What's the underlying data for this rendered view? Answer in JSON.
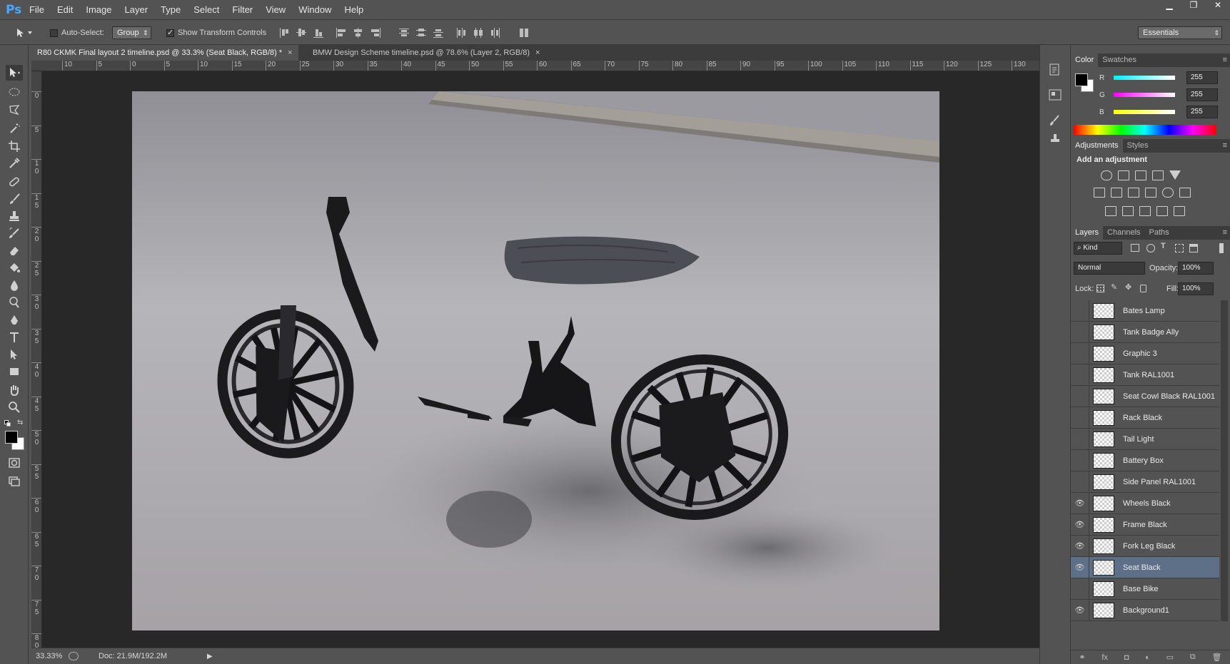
{
  "app": {
    "logo": "Ps"
  },
  "menu": [
    "File",
    "Edit",
    "Image",
    "Layer",
    "Type",
    "Select",
    "Filter",
    "View",
    "Window",
    "Help"
  ],
  "window_controls": {
    "minimize": "▁",
    "maximize": "❐",
    "close": "✕"
  },
  "options_bar": {
    "auto_select_label": "Auto-Select:",
    "auto_select_checked": false,
    "auto_select_target": "Group",
    "show_transform_label": "Show Transform Controls",
    "show_transform_checked": true,
    "workspace": "Essentials"
  },
  "tabs": [
    {
      "label": "R80 CKMK Final layout 2 timeline.psd @ 33.3% (Seat Black, RGB/8) *",
      "active": true,
      "close": "×"
    },
    {
      "label": "BMW Design Scheme timeline.psd @ 78.6% (Layer 2, RGB/8)",
      "active": false,
      "close": "×"
    }
  ],
  "ruler_h": [
    "10",
    "5",
    "0",
    "5",
    "10",
    "15",
    "20",
    "25",
    "30",
    "35",
    "40",
    "45",
    "50",
    "55",
    "60",
    "65",
    "70",
    "75",
    "80",
    "85",
    "90",
    "95",
    "100",
    "105",
    "110",
    "115",
    "120",
    "125",
    "130"
  ],
  "ruler_v": [
    "0",
    "5",
    "1 0",
    "1 5",
    "2 0",
    "2 5",
    "3 0",
    "3 5",
    "4 0",
    "4 5",
    "5 0",
    "5 5",
    "6 0",
    "6 5",
    "7 0",
    "7 5",
    "8 0"
  ],
  "status": {
    "zoom": "33.33%",
    "doc": "Doc: 21.9M/192.2M"
  },
  "color_panel": {
    "tabs": [
      "Color",
      "Swatches"
    ],
    "channels": [
      {
        "label": "R",
        "value": "255",
        "color": "#00e0ff"
      },
      {
        "label": "G",
        "value": "255",
        "color": "#ff30ff"
      },
      {
        "label": "B",
        "value": "255",
        "color": "#ffff20"
      }
    ]
  },
  "adjustments_panel": {
    "tabs": [
      "Adjustments",
      "Styles"
    ],
    "heading": "Add an adjustment"
  },
  "layers_panel": {
    "tabs": [
      "Layers",
      "Channels",
      "Paths"
    ],
    "filter_kind": "Kind",
    "blend_mode": "Normal",
    "opacity_label": "Opacity:",
    "opacity": "100%",
    "lock_label": "Lock:",
    "fill_label": "Fill:",
    "fill": "100%",
    "layers": [
      {
        "name": "Bates Lamp",
        "visible": false,
        "selected": false
      },
      {
        "name": "Tank Badge Ally",
        "visible": false,
        "selected": false
      },
      {
        "name": "Graphic 3",
        "visible": false,
        "selected": false
      },
      {
        "name": "Tank RAL1001",
        "visible": false,
        "selected": false
      },
      {
        "name": "Seat Cowl Black RAL1001",
        "visible": false,
        "selected": false
      },
      {
        "name": "Rack Black",
        "visible": false,
        "selected": false
      },
      {
        "name": "Tail Light",
        "visible": false,
        "selected": false
      },
      {
        "name": "Battery Box",
        "visible": false,
        "selected": false
      },
      {
        "name": "Side Panel RAL1001",
        "visible": false,
        "selected": false
      },
      {
        "name": "Wheels Black",
        "visible": true,
        "selected": false
      },
      {
        "name": "Frame Black",
        "visible": true,
        "selected": false
      },
      {
        "name": "Fork Leg Black",
        "visible": true,
        "selected": false
      },
      {
        "name": "Seat Black",
        "visible": true,
        "selected": true
      },
      {
        "name": "Base Bike",
        "visible": false,
        "selected": false
      },
      {
        "name": "Background1",
        "visible": true,
        "selected": false
      }
    ]
  }
}
